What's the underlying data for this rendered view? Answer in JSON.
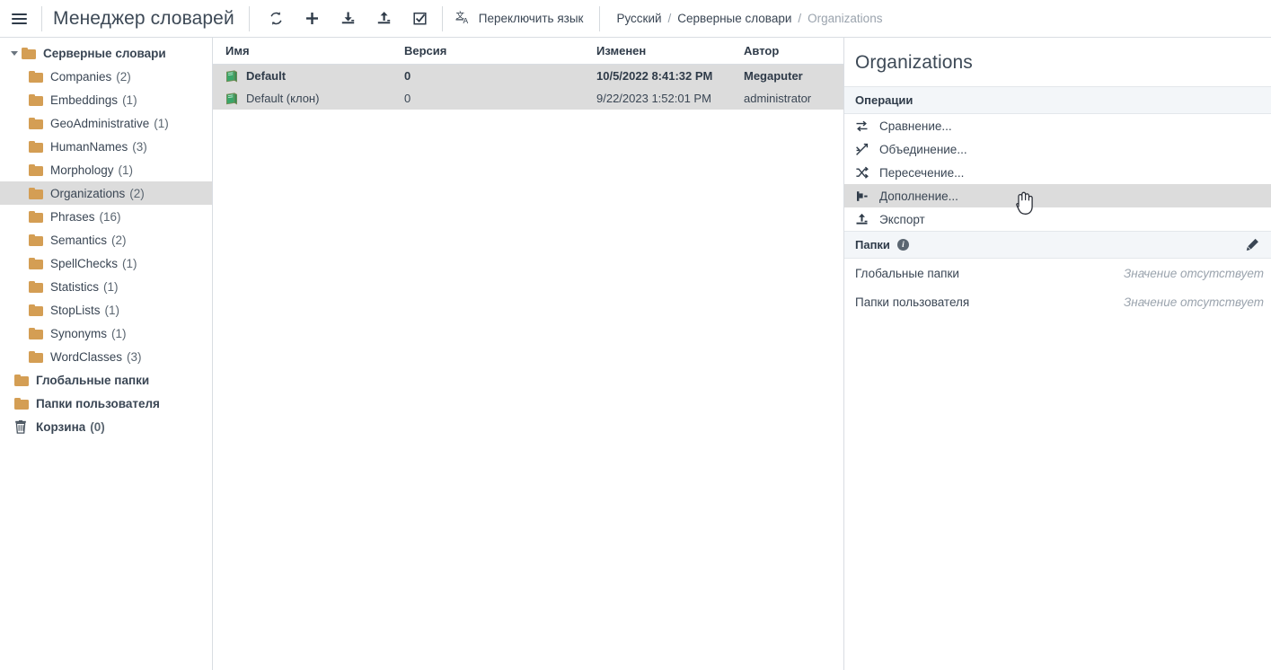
{
  "topbar": {
    "menu_icon": "hamburger-icon",
    "app_title": "Менеджер словарей",
    "tools": [
      {
        "name": "refresh-icon",
        "label": "Обновить"
      },
      {
        "name": "add-icon",
        "label": "Добавить"
      },
      {
        "name": "import-icon",
        "label": "Импорт"
      },
      {
        "name": "export-icon",
        "label": "Экспорт"
      },
      {
        "name": "select-checkbox-icon",
        "label": "Выбрать"
      }
    ],
    "language_button": {
      "icon": "translate-icon",
      "label": "Переключить язык"
    },
    "breadcrumb": {
      "items": [
        "Русский",
        "Серверные словари"
      ],
      "separator": "/",
      "current": "Organizations"
    }
  },
  "sidebar": {
    "root": {
      "label": "Серверные словари",
      "expanded": true
    },
    "items": [
      {
        "label": "Companies",
        "count": "(2)"
      },
      {
        "label": "Embeddings",
        "count": "(1)"
      },
      {
        "label": "GeoAdministrative",
        "count": "(1)"
      },
      {
        "label": "HumanNames",
        "count": "(3)"
      },
      {
        "label": "Morphology",
        "count": "(1)"
      },
      {
        "label": "Organizations",
        "count": "(2)",
        "selected": true
      },
      {
        "label": "Phrases",
        "count": "(16)"
      },
      {
        "label": "Semantics",
        "count": "(2)"
      },
      {
        "label": "SpellChecks",
        "count": "(1)"
      },
      {
        "label": "Statistics",
        "count": "(1)"
      },
      {
        "label": "StopLists",
        "count": "(1)"
      },
      {
        "label": "Synonyms",
        "count": "(1)"
      },
      {
        "label": "WordClasses",
        "count": "(3)"
      }
    ],
    "bottom_items": [
      {
        "label": "Глобальные папки",
        "count": "",
        "icon": "folder-icon"
      },
      {
        "label": "Папки пользователя",
        "count": "",
        "icon": "folder-icon"
      },
      {
        "label": "Корзина",
        "count": "(0)",
        "icon": "trash-icon"
      }
    ]
  },
  "table": {
    "columns": [
      "Имя",
      "Версия",
      "Изменен",
      "Автор"
    ],
    "rows": [
      {
        "name": "Default",
        "version": "0",
        "modified": "10/5/2022 8:41:32 PM",
        "author": "Megaputer",
        "selected": true,
        "bold": true
      },
      {
        "name": "Default (клон)",
        "version": "0",
        "modified": "9/22/2023 1:52:01 PM",
        "author": "administrator",
        "selected": true,
        "bold": false
      }
    ]
  },
  "right_panel": {
    "title": "Organizations",
    "operations": {
      "header": "Операции",
      "items": [
        {
          "label": "Сравнение...",
          "icon": "exchange-arrows-icon"
        },
        {
          "label": "Объединение...",
          "icon": "merge-arrows-icon"
        },
        {
          "label": "Пересечение...",
          "icon": "shuffle-arrows-icon"
        },
        {
          "label": "Дополнение...",
          "icon": "complement-icon",
          "hover": true
        },
        {
          "label": "Экспорт",
          "icon": "export-icon"
        }
      ]
    },
    "folders": {
      "header": "Папки",
      "info_icon": "info-icon",
      "edit_icon": "pencil-icon",
      "rows": [
        {
          "label": "Глобальные папки",
          "value": "Значение отсутствует"
        },
        {
          "label": "Папки пользователя",
          "value": "Значение отсутствует"
        }
      ]
    }
  },
  "colors": {
    "folder": "#d49e54",
    "book": "#3aa669",
    "selection": "#dcdcdc",
    "section_header": "#f3f6f9",
    "border": "#d9dde2",
    "text": "#3a4654",
    "muted": "#9aa3ad"
  }
}
